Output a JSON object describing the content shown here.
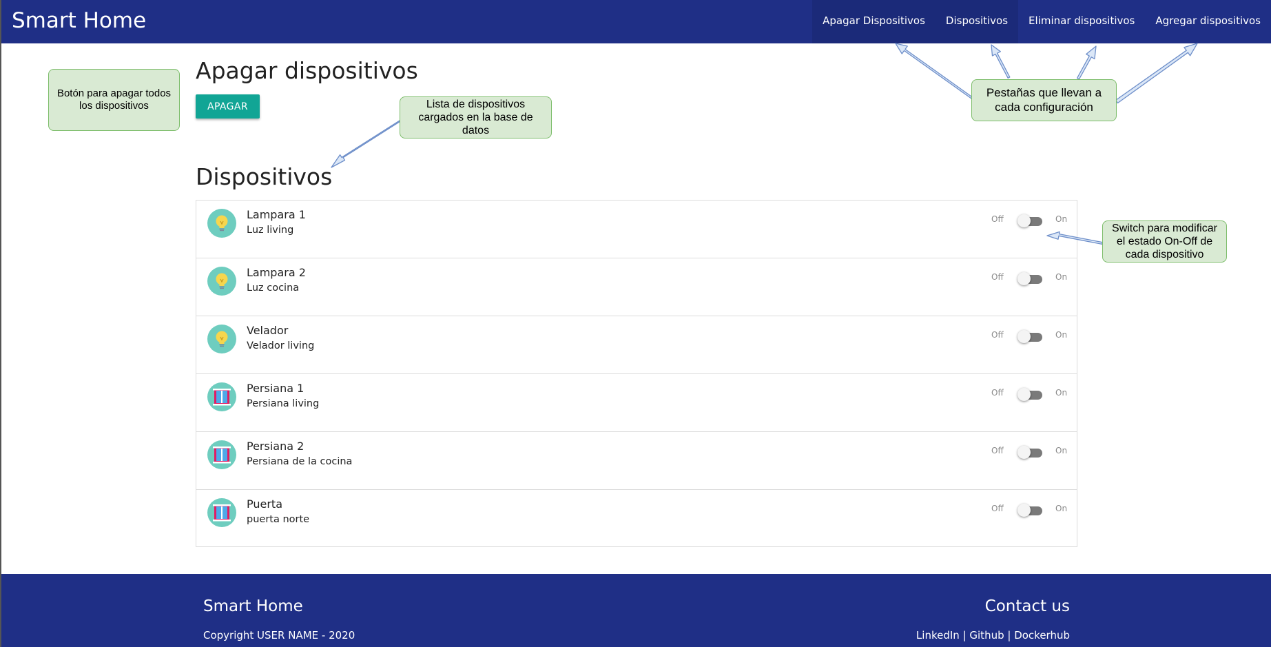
{
  "nav": {
    "brand": "Smart Home",
    "tabs": [
      {
        "label": "Apagar Dispositivos"
      },
      {
        "label": "Dispositivos"
      },
      {
        "label": "Eliminar dispositivos"
      },
      {
        "label": "Agregar dispositivos"
      }
    ]
  },
  "main": {
    "apagar_title": "Apagar dispositivos",
    "apagar_button": "APAGAR",
    "dispositivos_title": "Dispositivos",
    "switch_off_label": "Off",
    "switch_on_label": "On",
    "devices": [
      {
        "name": "Lampara 1",
        "description": "Luz living",
        "icon": "lightbulb-icon",
        "state": "off"
      },
      {
        "name": "Lampara 2",
        "description": "Luz cocina",
        "icon": "lightbulb-icon",
        "state": "off"
      },
      {
        "name": "Velador",
        "description": "Velador living",
        "icon": "lightbulb-icon",
        "state": "off"
      },
      {
        "name": "Persiana 1",
        "description": "Persiana living",
        "icon": "window-blind-icon",
        "state": "off"
      },
      {
        "name": "Persiana 2",
        "description": "Persiana de la cocina",
        "icon": "window-blind-icon",
        "state": "off"
      },
      {
        "name": "Puerta",
        "description": "puerta norte",
        "icon": "window-blind-icon",
        "state": "off"
      }
    ]
  },
  "annotations": {
    "apagar_note": "Botón para apagar todos los dispositivos",
    "list_note": "Lista de dispositivos cargados en la base de datos",
    "tabs_note": "Pestañas que llevan a cada configuración",
    "switch_note": "Switch para modificar el estado On-Off de cada dispositivo"
  },
  "footer": {
    "brand": "Smart Home",
    "copyright": "Copyright USER NAME - 2020",
    "contact_title": "Contact us",
    "links": [
      {
        "label": "LinkedIn"
      },
      {
        "label": "Github"
      },
      {
        "label": "Dockerhub"
      }
    ],
    "separator": " | "
  },
  "colors": {
    "navbar": "#1f2f86",
    "accent": "#11a595",
    "icon_bg": "#6ecdbf",
    "callout_bg": "#d9ead3",
    "callout_border": "#7cbd6a",
    "arrow_fill": "#dbe7f7",
    "arrow_stroke": "#6d8ec9"
  }
}
